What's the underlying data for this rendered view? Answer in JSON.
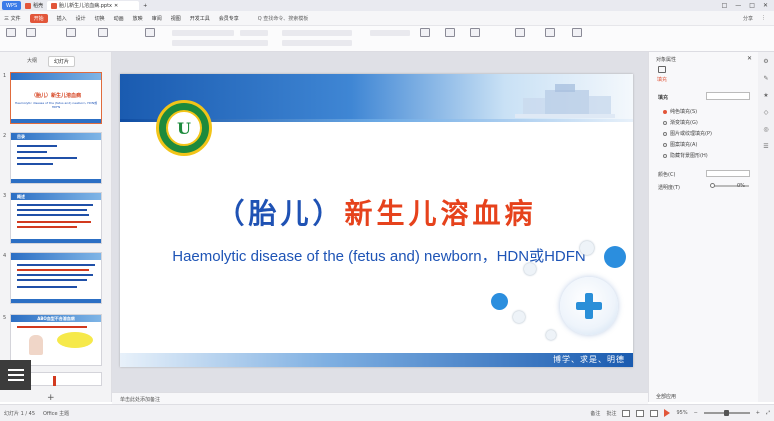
{
  "titlebar": {
    "app_tab": "WPS",
    "doc_tab": "稻壳",
    "file_tab": "胎儿新生儿溶血病.pptx",
    "right_items": [
      "□",
      "—",
      "□",
      "✕"
    ]
  },
  "menubar": {
    "items": [
      "三 文件",
      "开始",
      "插入",
      "设计",
      "切换",
      "动画",
      "放映",
      "审阅",
      "视图",
      "开发工具",
      "会员专享"
    ],
    "active_index": 1,
    "search": "Q 查找命令、搜索模板",
    "right": [
      "分享",
      "⋮"
    ]
  },
  "leftpanel": {
    "tabs": [
      "大纲",
      "幻灯片"
    ],
    "thumbs": [
      {
        "num": "1",
        "title": "（胎儿）新生儿溶血病",
        "sub": "Haemolytic disease of the (fetus and) newborn, HDN或HDFN"
      },
      {
        "num": "2",
        "title": "目录"
      },
      {
        "num": "3",
        "title": "概述"
      },
      {
        "num": "4",
        "title": ""
      },
      {
        "num": "5",
        "title": "ABO血型不合溶血病"
      }
    ],
    "add": "+"
  },
  "slide": {
    "logo_letter": "U",
    "zh_paren_left": "（胎儿）",
    "zh_main": "新生儿溶血病",
    "en_title": "Haemolytic disease of the (fetus and) newborn，HDN或HDFN",
    "slogan": "博学、求是、明德"
  },
  "notes": {
    "placeholder": "单击此处添加备注"
  },
  "rightpanel": {
    "title": "对象属性",
    "fill_label": "填充",
    "section": "填充",
    "options": [
      "纯色填充(S)",
      "渐变填充(G)",
      "图片或纹理填充(P)",
      "图案填充(A)",
      "隐藏背景图形(H)"
    ],
    "selected_option": 0,
    "color_label": "颜色(C)",
    "transparency_label": "透明度(T)",
    "transparency_value": "0%",
    "bottom": "全部应用"
  },
  "statusbar": {
    "slide_info": "幻灯片 1 / 45",
    "theme": "Office 主题",
    "notes_btn": "备注",
    "comment_btn": "批注",
    "zoom": "95%"
  },
  "colors": {
    "accent": "#e2563a",
    "title_blue": "#1e54b6",
    "title_red": "#e6421c",
    "header_blue": "#1a5bb0"
  }
}
